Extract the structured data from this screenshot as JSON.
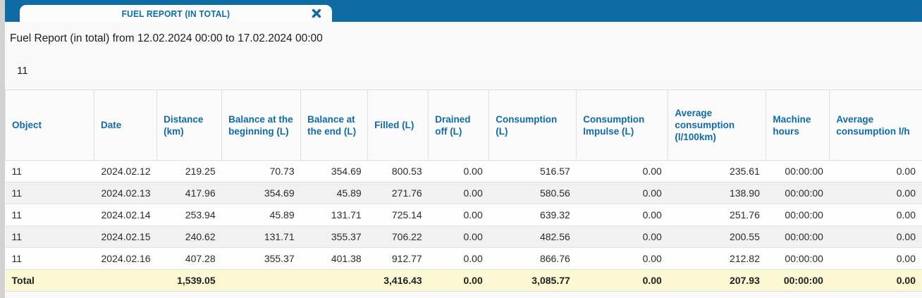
{
  "tab": {
    "label": "FUEL REPORT (IN TOTAL)"
  },
  "report": {
    "title": "Fuel Report (in total) from 12.02.2024 00:00 to 17.02.2024 00:00",
    "object_name": "11"
  },
  "table": {
    "columns": [
      "Object",
      "Date",
      "Distance (km)",
      "Balance at the beginning (L)",
      "Balance at the end (L)",
      "Filled (L)",
      "Drained off (L)",
      "Consumption (L)",
      "Consumption Impulse (L)",
      "Average consumption (l/100km)",
      "Machine hours",
      "Average consumption l/h"
    ],
    "rows": [
      [
        "11",
        "2024.02.12",
        "219.25",
        "70.73",
        "354.69",
        "800.53",
        "0.00",
        "516.57",
        "0.00",
        "235.61",
        "00:00:00",
        "0.00"
      ],
      [
        "11",
        "2024.02.13",
        "417.96",
        "354.69",
        "45.89",
        "271.76",
        "0.00",
        "580.56",
        "0.00",
        "138.90",
        "00:00:00",
        "0.00"
      ],
      [
        "11",
        "2024.02.14",
        "253.94",
        "45.89",
        "131.71",
        "725.14",
        "0.00",
        "639.32",
        "0.00",
        "251.76",
        "00:00:00",
        "0.00"
      ],
      [
        "11",
        "2024.02.15",
        "240.62",
        "131.71",
        "355.37",
        "706.22",
        "0.00",
        "482.56",
        "0.00",
        "200.55",
        "00:00:00",
        "0.00"
      ],
      [
        "11",
        "2024.02.16",
        "407.28",
        "355.37",
        "401.38",
        "912.77",
        "0.00",
        "866.76",
        "0.00",
        "212.82",
        "00:00:00",
        "0.00"
      ]
    ],
    "total_row": [
      "Total",
      "",
      "1,539.05",
      "",
      "",
      "3,416.43",
      "0.00",
      "3,085.77",
      "0.00",
      "207.93",
      "00:00:00",
      "0.00"
    ]
  },
  "colors": {
    "accent_blue": "#0f6ba3",
    "total_row_bg": "#fbf8d3"
  }
}
